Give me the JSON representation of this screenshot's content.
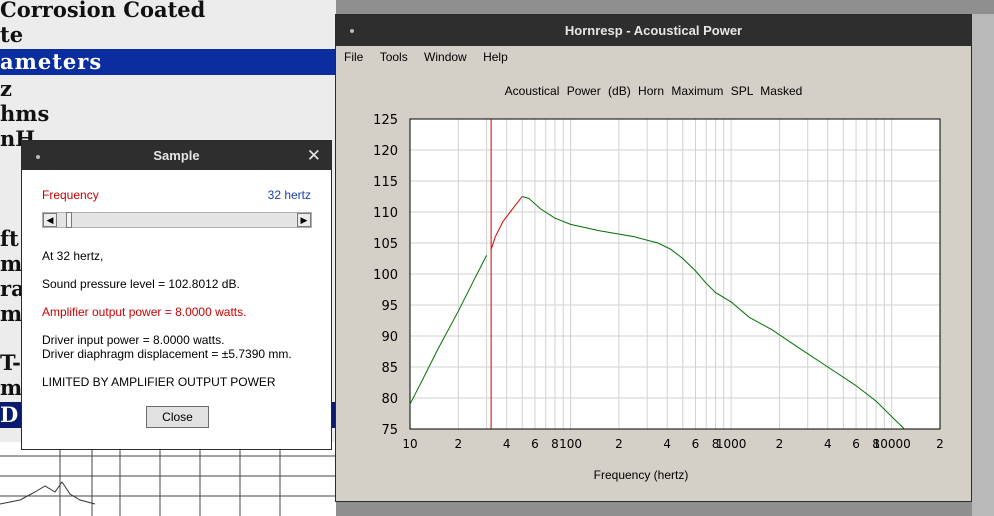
{
  "background_app": {
    "rows": [
      "Corrosion Coated",
      "te",
      "ameters",
      "z",
      "hms",
      "nH",
      "ft",
      "m",
      "ra",
      "m",
      "T-",
      "m",
      "D"
    ]
  },
  "hornresp": {
    "title": "Hornresp - Acoustical Power",
    "menu": [
      "File",
      "Tools",
      "Window",
      "Help"
    ],
    "chart_title": "Acoustical Power (dB)   Horn   Maximum SPL   Masked"
  },
  "chart_data": {
    "type": "line",
    "title": "Acoustical Power (dB)   Horn   Maximum SPL   Masked",
    "xlabel": "Frequency (hertz)",
    "ylabel": "",
    "x_scale": "log",
    "xlim": [
      10,
      20000
    ],
    "ylim": [
      75,
      125
    ],
    "y_ticks": [
      75,
      80,
      85,
      90,
      95,
      100,
      105,
      110,
      115,
      120,
      125
    ],
    "x_tick_labels": [
      {
        "x": 10,
        "label": "10"
      },
      {
        "x": 20,
        "label": "2"
      },
      {
        "x": 40,
        "label": "4"
      },
      {
        "x": 60,
        "label": "6"
      },
      {
        "x": 80,
        "label": "8"
      },
      {
        "x": 100,
        "label": "100"
      },
      {
        "x": 200,
        "label": "2"
      },
      {
        "x": 400,
        "label": "4"
      },
      {
        "x": 600,
        "label": "6"
      },
      {
        "x": 800,
        "label": "8"
      },
      {
        "x": 1000,
        "label": "1000"
      },
      {
        "x": 2000,
        "label": "2"
      },
      {
        "x": 4000,
        "label": "4"
      },
      {
        "x": 6000,
        "label": "6"
      },
      {
        "x": 8000,
        "label": "8"
      },
      {
        "x": 10000,
        "label": "10000"
      },
      {
        "x": 20000,
        "label": "2"
      }
    ],
    "grid": true,
    "marker_frequency": 32,
    "series": [
      {
        "color": "#007000",
        "points": [
          [
            10,
            79
          ],
          [
            12,
            83
          ],
          [
            15,
            88
          ],
          [
            20,
            94
          ],
          [
            25,
            99
          ],
          [
            30,
            103
          ]
        ]
      },
      {
        "color": "#e00000",
        "points": [
          [
            32,
            104
          ],
          [
            34,
            106
          ],
          [
            38,
            108.5
          ],
          [
            45,
            111
          ],
          [
            50,
            112.5
          ]
        ]
      },
      {
        "color": "#007000",
        "points": [
          [
            50,
            112.5
          ],
          [
            55,
            112.2
          ],
          [
            65,
            110.5
          ],
          [
            80,
            109
          ],
          [
            100,
            108
          ],
          [
            150,
            107
          ],
          [
            250,
            106
          ],
          [
            350,
            105
          ],
          [
            420,
            104
          ],
          [
            500,
            102.5
          ],
          [
            600,
            100.5
          ],
          [
            700,
            98.5
          ],
          [
            800,
            97
          ],
          [
            1000,
            95.5
          ],
          [
            1300,
            93
          ],
          [
            1800,
            91
          ],
          [
            2500,
            88.5
          ],
          [
            4000,
            85
          ],
          [
            6000,
            82
          ],
          [
            8000,
            79.5
          ],
          [
            10000,
            77
          ],
          [
            12000,
            75
          ]
        ]
      }
    ]
  },
  "sample": {
    "title": "Sample",
    "close_glyph": "✕",
    "freq_label": "Frequency",
    "freq_value": "32 hertz",
    "slider_left": "◀",
    "slider_right": "▶",
    "line_at": "At 32 hertz,",
    "line_spl": "Sound pressure level = 102.8012 dB.",
    "line_amp": "Amplifier output power = 8.0000 watts.",
    "line_input": "Driver input power = 8.0000 watts.",
    "line_disp": "Driver diaphragm displacement = ±5.7390 mm.",
    "line_limited": "LIMITED BY AMPLIFIER OUTPUT POWER",
    "close_button": "Close",
    "colors": {
      "red": "#cc0000",
      "blue": "#1a3fa8"
    }
  }
}
